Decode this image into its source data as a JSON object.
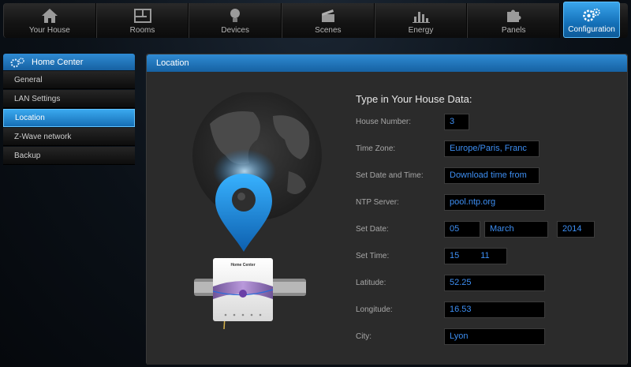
{
  "nav": {
    "items": [
      {
        "label": "Your House",
        "icon": "house-icon"
      },
      {
        "label": "Rooms",
        "icon": "rooms-icon"
      },
      {
        "label": "Devices",
        "icon": "bulb-icon"
      },
      {
        "label": "Scenes",
        "icon": "clapperboard-icon"
      },
      {
        "label": "Energy",
        "icon": "bar-chart-icon"
      },
      {
        "label": "Panels",
        "icon": "puzzle-icon"
      }
    ],
    "active": {
      "label": "Configuration",
      "icon": "gears-icon"
    }
  },
  "sidebar": {
    "header": "Home Center",
    "items": [
      {
        "label": "General"
      },
      {
        "label": "LAN Settings"
      },
      {
        "label": "Location",
        "selected": true
      },
      {
        "label": "Z-Wave network"
      },
      {
        "label": "Backup"
      }
    ]
  },
  "panel": {
    "title": "Location",
    "device_label": "Home Center",
    "form": {
      "title": "Type in Your House Data:",
      "house_number": {
        "label": "House Number:",
        "value": "3"
      },
      "time_zone": {
        "label": "Time Zone:",
        "value": "Europe/Paris, Franc"
      },
      "set_date_time": {
        "label": "Set Date and Time:",
        "value": "Download time from"
      },
      "ntp_server": {
        "label": "NTP Server:",
        "value": "pool.ntp.org"
      },
      "set_date": {
        "label": "Set Date:",
        "day": "05",
        "month": "March",
        "year": "2014"
      },
      "set_time": {
        "label": "Set Time:",
        "hour": "15",
        "minute": "11"
      },
      "latitude": {
        "label": "Latitude:",
        "value": "52.25"
      },
      "longitude": {
        "label": "Longitude:",
        "value": "16.53"
      },
      "city": {
        "label": "City:",
        "value": "Lyon"
      }
    }
  },
  "colors": {
    "accent_blue": "#1b78c4",
    "field_text": "#3d8ef2",
    "panel_bg": "#2b2b2b"
  }
}
